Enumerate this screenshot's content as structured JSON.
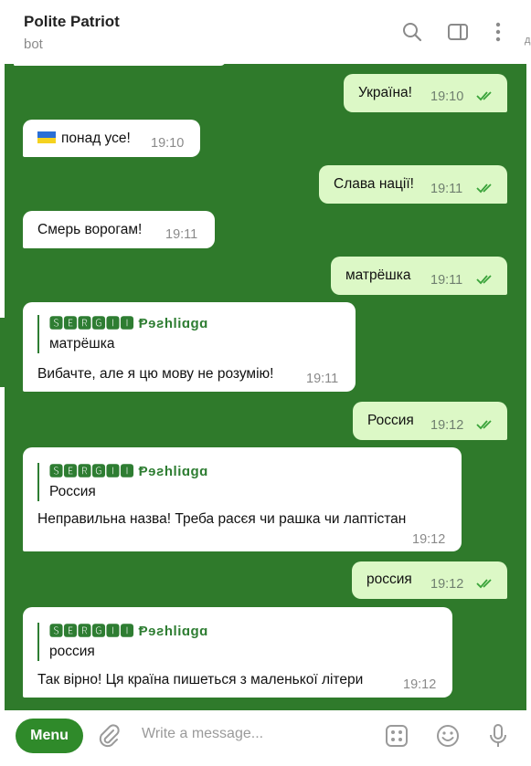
{
  "header": {
    "title": "Polite Patriot",
    "subtitle": "bot",
    "edge_char": "д"
  },
  "colors": {
    "chat_bg": "#2f7a2b",
    "outgoing": "#dcf8c6",
    "incoming": "#ffffff",
    "accent": "#2f8a2a"
  },
  "messages": [
    {
      "dir": "out",
      "text": "Україна!",
      "time": "19:10",
      "read": true
    },
    {
      "dir": "in",
      "text": "понад усе!",
      "flag": "ua-flag",
      "time": "19:10"
    },
    {
      "dir": "out",
      "text": "Слава нації!",
      "time": "19:11",
      "read": true
    },
    {
      "dir": "in",
      "text": "Смерь ворогам!",
      "time": "19:11"
    },
    {
      "dir": "out",
      "text": "матрёшка",
      "time": "19:11",
      "read": true
    },
    {
      "dir": "in",
      "reply_name": "🆂🅴🆁🅶🅸🅸 Ᵽɘƨhliɑgɑ",
      "reply_text": "матрёшка",
      "text": "Вибачте, але я цю мову не розумію!",
      "time": "19:11"
    },
    {
      "dir": "out",
      "text": "Россия",
      "time": "19:12",
      "read": true
    },
    {
      "dir": "in",
      "reply_name": "🆂🅴🆁🅶🅸🅸 Ᵽɘƨhliɑgɑ",
      "reply_text": "Россия",
      "text": "Неправильна назва! Треба расєя чи рашка чи лаптістан",
      "time": "19:12"
    },
    {
      "dir": "out",
      "text": "россия",
      "time": "19:12",
      "read": true
    },
    {
      "dir": "in",
      "reply_name": "🆂🅴🆁🅶🅸🅸 Ᵽɘƨhliɑgɑ",
      "reply_text": "россия",
      "text": "Так вірно! Ця країна пишеться з маленької літери",
      "time": "19:12"
    }
  ],
  "composer": {
    "menu_label": "Menu",
    "placeholder": "Write a message..."
  },
  "icons": [
    "search-icon",
    "sidebar-toggle-icon",
    "more-vertical-icon",
    "attach-icon",
    "bot-keyboard-icon",
    "emoji-icon",
    "microphone-icon"
  ]
}
